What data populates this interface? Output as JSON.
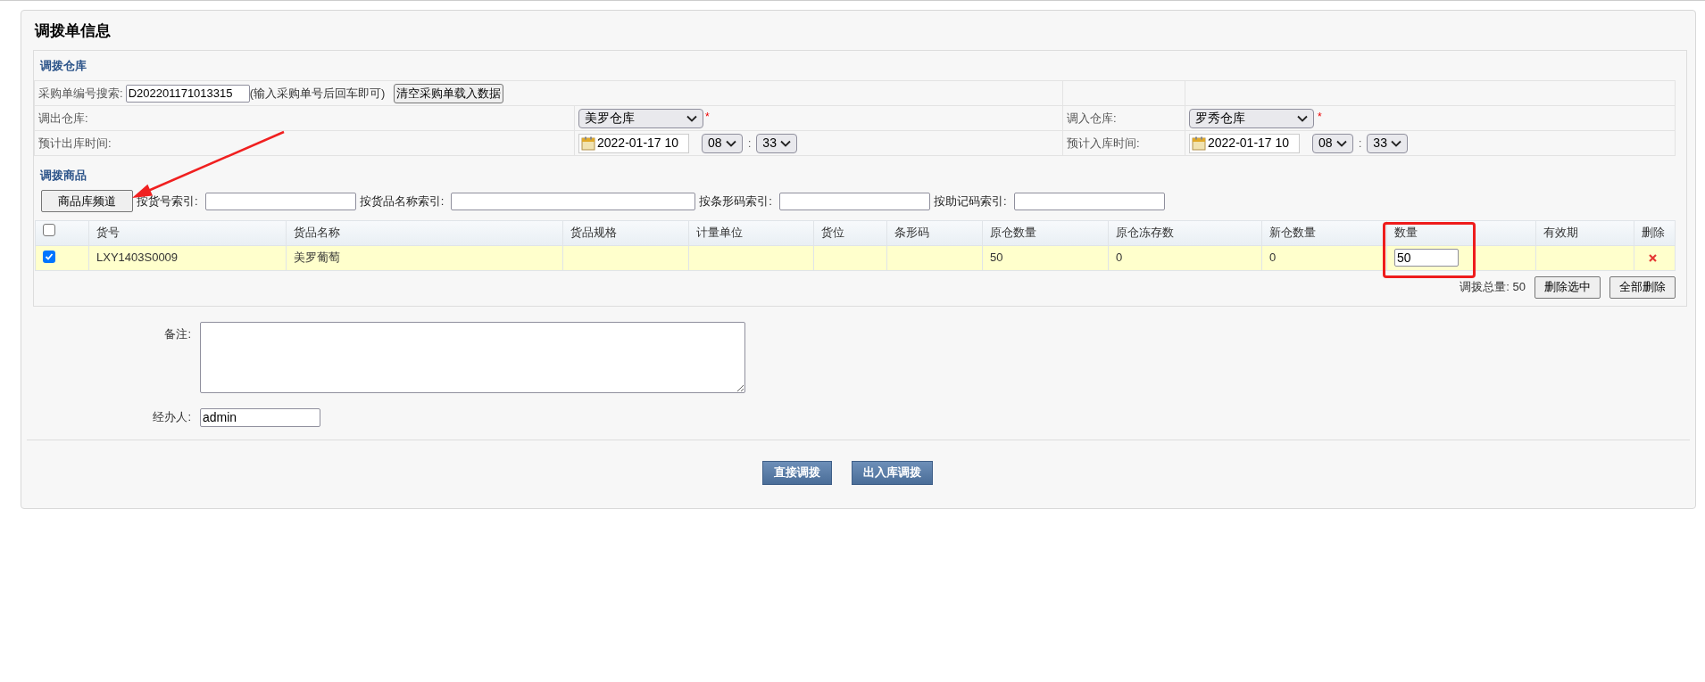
{
  "page_title": "调拨单信息",
  "warehouse_section": {
    "heading": "调拨仓库",
    "po_search": {
      "label": "采购单编号搜索:",
      "value": "D202201171013315",
      "hint": "(输入采购单号后回车即可)",
      "button": "清空采购单载入数据"
    },
    "from": {
      "label": "调出仓库:",
      "value": "美罗仓库",
      "required_mark": "*"
    },
    "to": {
      "label": "调入仓库:",
      "value": "罗秀仓库",
      "required_mark": "*"
    },
    "out_time": {
      "label": "预计出库时间:",
      "date": "2022-01-17 10",
      "hour": "08",
      "separator": ":",
      "minute": "33"
    },
    "in_time": {
      "label": "预计入库时间:",
      "date": "2022-01-17 10",
      "hour": "08",
      "separator": ":",
      "minute": "33"
    }
  },
  "goods_section": {
    "heading": "调拨商品",
    "channel_button": "商品库频道",
    "filters": [
      "按货号索引:",
      "按货品名称索引:",
      "按条形码索引:",
      "按助记码索引:"
    ],
    "select_all": {
      "checked": false
    },
    "columns": [
      "货号",
      "货品名称",
      "货品规格",
      "计量单位",
      "货位",
      "条形码",
      "原仓数量",
      "原仓冻存数",
      "新仓数量",
      "数量",
      "有效期",
      "删除"
    ],
    "rows": [
      {
        "checked": true,
        "code": "LXY1403S0009",
        "name": "美罗葡萄",
        "orig_qty": "50",
        "frozen_qty": "0",
        "new_qty": "0",
        "quantity": "50"
      }
    ],
    "total": "调拨总量: 50",
    "buttons": [
      "删除选中",
      "全部删除"
    ]
  },
  "remark": {
    "label": "备注:"
  },
  "handler": {
    "label": "经办人:",
    "value": "admin"
  },
  "actions": [
    "直接调拨",
    "出入库调拨"
  ]
}
